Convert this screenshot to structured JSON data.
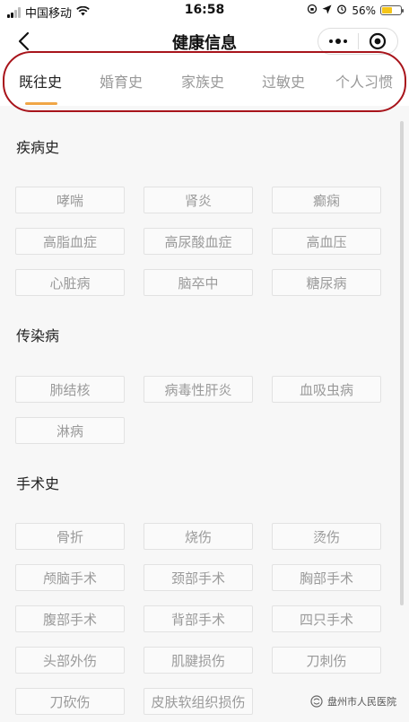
{
  "status_bar": {
    "carrier": "中国移动",
    "time": "16:58",
    "battery": "56%",
    "battery_level": 0.56
  },
  "nav": {
    "title": "健康信息"
  },
  "tabs": [
    {
      "label": "既往史",
      "active": true
    },
    {
      "label": "婚育史",
      "active": false
    },
    {
      "label": "家族史",
      "active": false
    },
    {
      "label": "过敏史",
      "active": false
    },
    {
      "label": "个人习惯",
      "active": false
    }
  ],
  "sections": [
    {
      "title": "疾病史",
      "items": [
        "哮喘",
        "肾炎",
        "癫痫",
        "高脂血症",
        "高尿酸血症",
        "高血压",
        "心脏病",
        "脑卒中",
        "糖尿病"
      ]
    },
    {
      "title": "传染病",
      "items": [
        "肺结核",
        "病毒性肝炎",
        "血吸虫病",
        "淋病"
      ]
    },
    {
      "title": "手术史",
      "items": [
        "骨折",
        "烧伤",
        "烫伤",
        "颅脑手术",
        "颈部手术",
        "胸部手术",
        "腹部手术",
        "背部手术",
        "四只手术",
        "头部外伤",
        "肌腱损伤",
        "刀刺伤",
        "刀砍伤",
        "皮肤软组织损伤"
      ]
    }
  ],
  "watermark": "盘州市人民医院",
  "colors": {
    "accent": "#f0a646",
    "outline": "#a8141b"
  }
}
